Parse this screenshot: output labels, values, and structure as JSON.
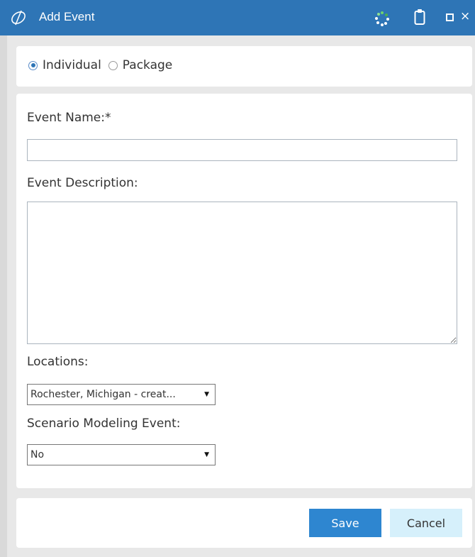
{
  "window": {
    "title": "Add Event",
    "accent_color": "#2e75b6"
  },
  "event_type": {
    "options": [
      {
        "label": "Individual",
        "selected": true
      },
      {
        "label": "Package",
        "selected": false
      }
    ]
  },
  "form": {
    "event_name_label": "Event Name:*",
    "event_name_value": "",
    "event_description_label": "Event Description:",
    "event_description_value": "",
    "locations_label": "Locations:",
    "locations_selected": "Rochester, Michigan - creat...",
    "scenario_label": "Scenario Modeling Event:",
    "scenario_selected": "No"
  },
  "footer": {
    "save_label": "Save",
    "cancel_label": "Cancel"
  },
  "icons": {
    "app_logo": "app-logo-icon",
    "loading": "loading-spinner-icon",
    "clipboard": "clipboard-icon",
    "maximize": "maximize-icon",
    "close": "close-icon"
  }
}
